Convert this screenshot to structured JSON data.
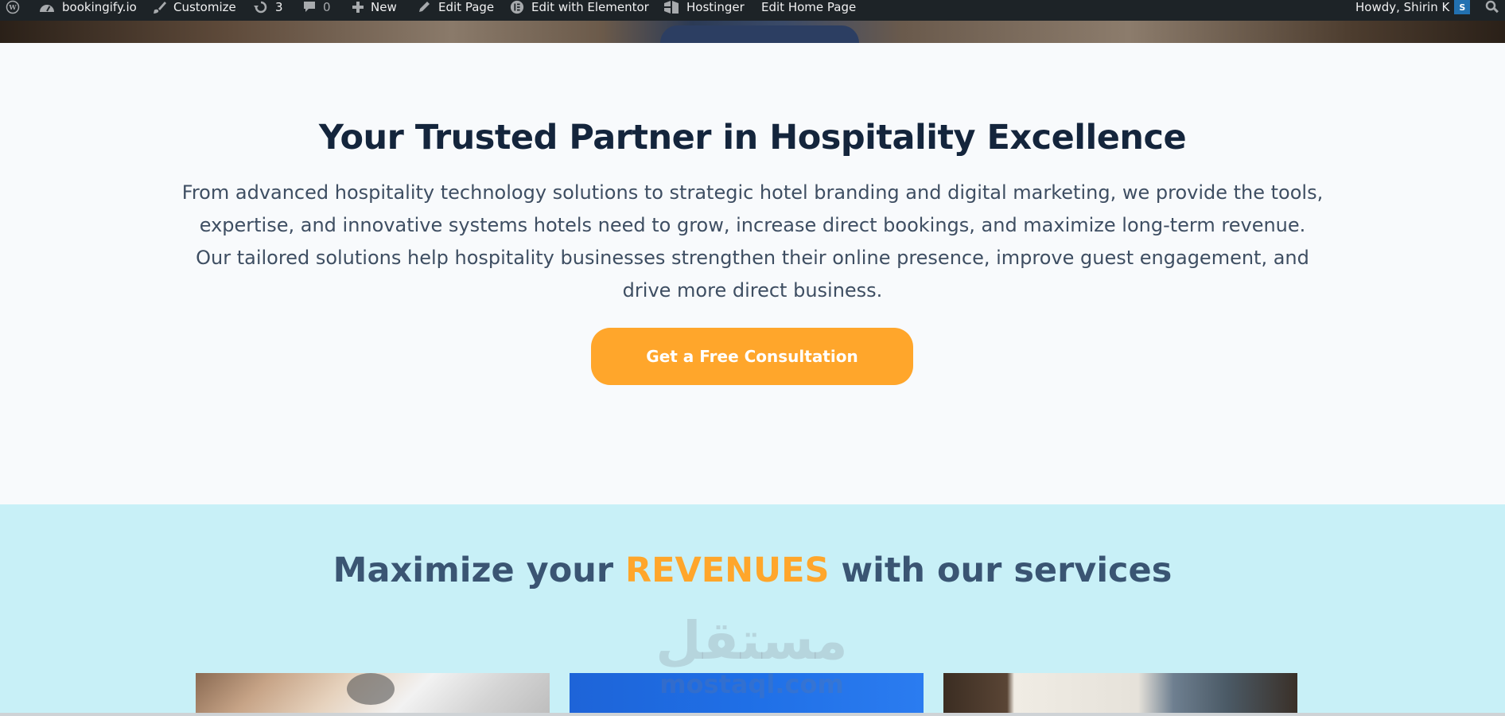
{
  "admin_bar": {
    "site_name": "bookingify.io",
    "customize": "Customize",
    "updates_count": "3",
    "comments_count": "0",
    "new": "New",
    "edit_page": "Edit Page",
    "edit_elementor": "Edit with Elementor",
    "hostinger": "Hostinger",
    "edit_home": "Edit Home Page",
    "howdy": "Howdy, Shirin K",
    "avatar_initial": "S"
  },
  "partner": {
    "title": "Your Trusted Partner in Hospitality Excellence",
    "description": "From advanced hospitality technology solutions to strategic hotel branding and digital marketing, we provide the tools, expertise, and innovative systems hotels need to grow, increase direct bookings, and maximize long-term revenue. Our tailored solutions help hospitality businesses strengthen their online presence, improve guest engagement, and drive more direct business.",
    "cta_label": "Get a Free Consultation"
  },
  "services": {
    "title_before": "Maximize your ",
    "title_highlight": "REVENUES",
    "title_after": " with our services"
  },
  "watermark": {
    "arabic": "مستقل",
    "latin": "mostaql.com"
  },
  "colors": {
    "admin_bar": "#1d2327",
    "accent": "#ffa62b",
    "heading": "#14253c",
    "services_bg": "#c8f0f7"
  }
}
